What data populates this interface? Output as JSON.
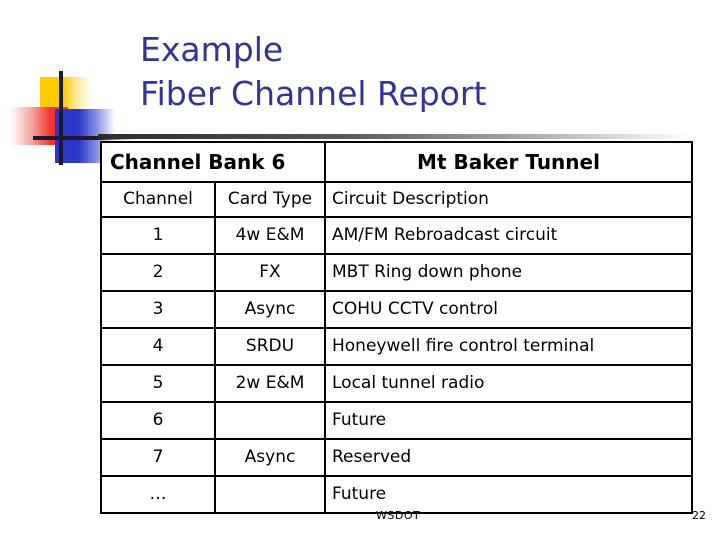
{
  "slide": {
    "title_lines": [
      "Example",
      "Fiber Channel Report"
    ],
    "title_color": "#333399"
  },
  "decoration": {
    "yellow": "#FFCC00",
    "red": "#F4342E",
    "blue": "#2B37C8",
    "crosshair": "#1A1A2E"
  },
  "table": {
    "group_headers": {
      "bank": "Channel Bank 6",
      "tunnel": "Mt Baker Tunnel"
    },
    "columns": [
      "Channel",
      "Card Type",
      "Circuit Description"
    ],
    "rows": [
      {
        "channel": "1",
        "card_type": "4w E&M",
        "description": "AM/FM Rebroadcast circuit"
      },
      {
        "channel": "2",
        "card_type": "FX",
        "description": "MBT Ring down phone"
      },
      {
        "channel": "3",
        "card_type": "Async",
        "description": "COHU CCTV control"
      },
      {
        "channel": "4",
        "card_type": "SRDU",
        "description": "Honeywell fire control terminal"
      },
      {
        "channel": "5",
        "card_type": "2w E&M",
        "description": "Local tunnel radio"
      },
      {
        "channel": "6",
        "card_type": "",
        "description": "Future"
      },
      {
        "channel": "7",
        "card_type": "Async",
        "description": "Reserved"
      },
      {
        "channel": "…",
        "card_type": "",
        "description": "Future"
      }
    ]
  },
  "footer": {
    "organization": "WSDOT",
    "page_number": "22"
  }
}
